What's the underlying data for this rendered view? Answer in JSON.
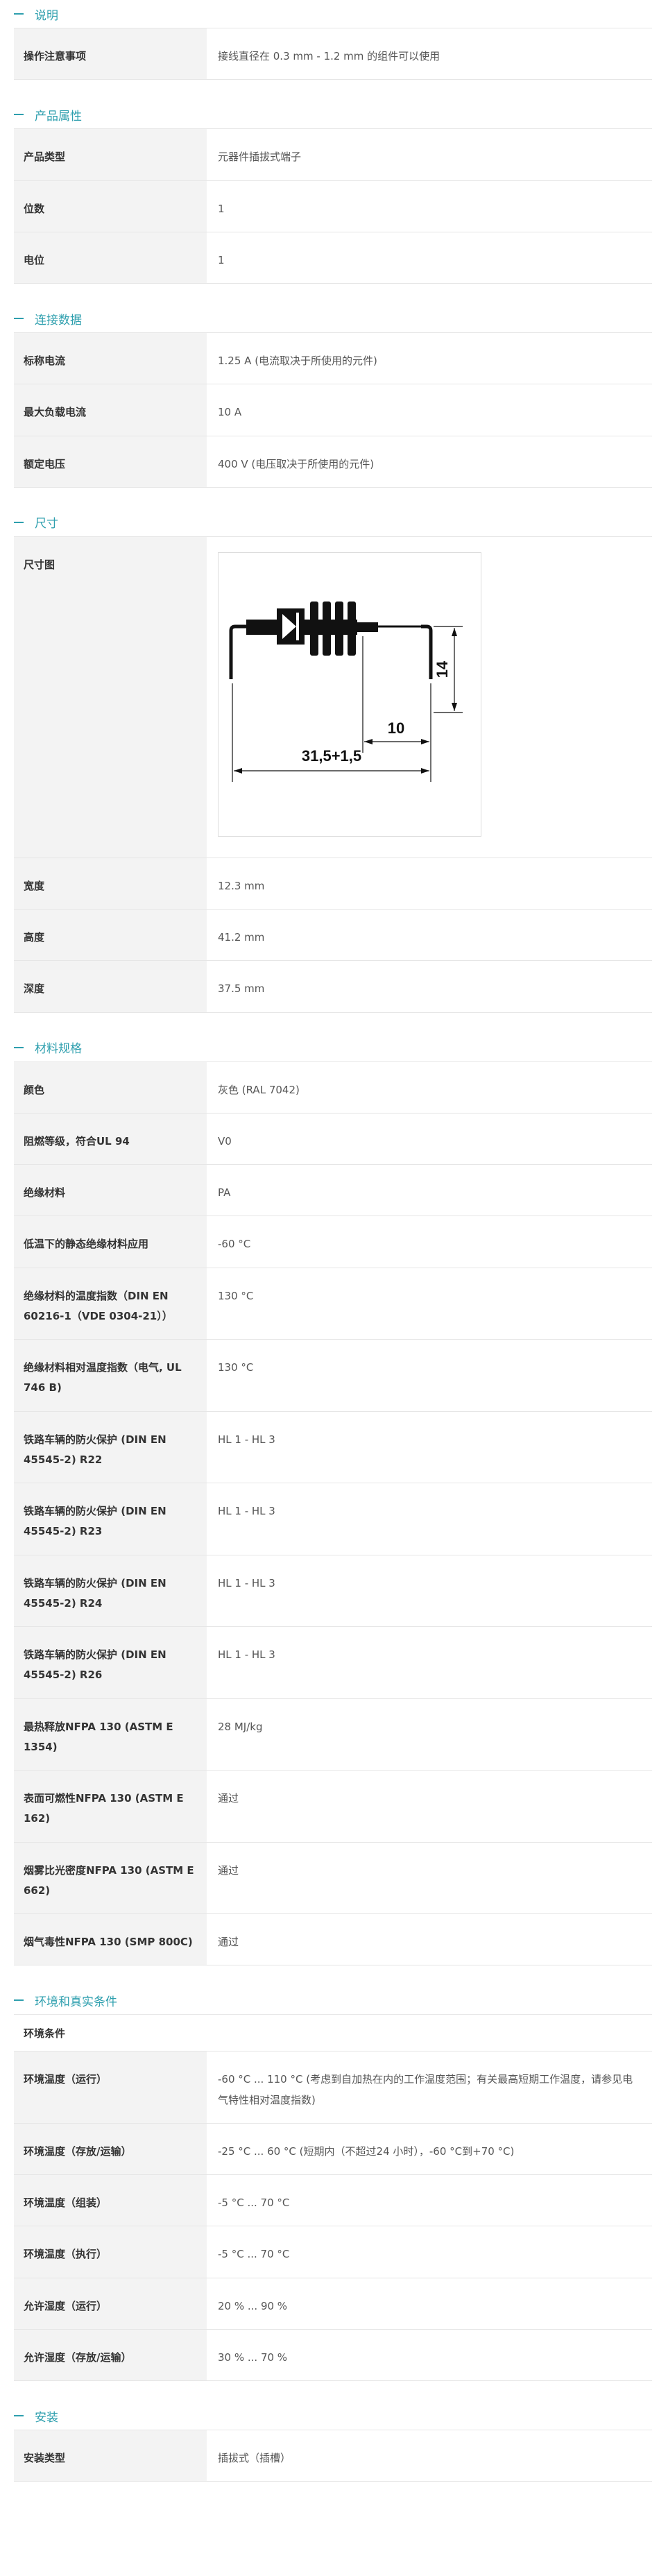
{
  "sections": {
    "description": {
      "title": "说明",
      "rows": [
        {
          "label": "操作注意事项",
          "value": "接线直径在 0.3 mm - 1.2 mm 的组件可以使用"
        }
      ]
    },
    "product": {
      "title": "产品属性",
      "rows": [
        {
          "label": "产品类型",
          "value": "元器件插拔式端子"
        },
        {
          "label": "位数",
          "value": "1"
        },
        {
          "label": "电位",
          "value": "1"
        }
      ]
    },
    "connection": {
      "title": "连接数据",
      "rows": [
        {
          "label": "标称电流",
          "value": "1.25 A (电流取决于所使用的元件)"
        },
        {
          "label": "最大负载电流",
          "value": "10 A"
        },
        {
          "label": "额定电压",
          "value": "400 V (电压取决于所使用的元件)"
        }
      ]
    },
    "dimensions": {
      "title": "尺寸",
      "drawing_label": "尺寸图",
      "drawing": {
        "dim_width": "31,5+1,5",
        "dim_gap": "10",
        "dim_height": "14"
      },
      "rows": [
        {
          "label": "宽度",
          "value": "12.3 mm"
        },
        {
          "label": "高度",
          "value": "41.2 mm"
        },
        {
          "label": "深度",
          "value": "37.5 mm"
        }
      ]
    },
    "material": {
      "title": "材料规格",
      "rows": [
        {
          "label": "颜色",
          "value": "灰色 (RAL 7042)"
        },
        {
          "label": "阻燃等级，符合UL 94",
          "value": "V0"
        },
        {
          "label": "绝缘材料",
          "value": "PA"
        },
        {
          "label": "低温下的静态绝缘材料应用",
          "value": "-60 °C"
        },
        {
          "label": "绝缘材料的温度指数（DIN EN 60216-1（VDE 0304-21））",
          "value": "130 °C"
        },
        {
          "label": "绝缘材料相对温度指数（电气, UL 746 B)",
          "value": "130 °C"
        },
        {
          "label": "铁路车辆的防火保护 (DIN EN 45545-2) R22",
          "value": "HL 1 - HL 3"
        },
        {
          "label": "铁路车辆的防火保护 (DIN EN 45545-2) R23",
          "value": "HL 1 - HL 3"
        },
        {
          "label": "铁路车辆的防火保护 (DIN EN 45545-2) R24",
          "value": "HL 1 - HL 3"
        },
        {
          "label": "铁路车辆的防火保护 (DIN EN 45545-2) R26",
          "value": "HL 1 - HL 3"
        },
        {
          "label": "最热释放NFPA 130 (ASTM E 1354)",
          "value": "28 MJ/kg"
        },
        {
          "label": "表面可燃性NFPA 130 (ASTM E 162)",
          "value": "通过"
        },
        {
          "label": "烟雾比光密度NFPA 130 (ASTM E 662)",
          "value": "通过"
        },
        {
          "label": "烟气毒性NFPA 130 (SMP 800C)",
          "value": "通过"
        }
      ]
    },
    "environment": {
      "title": "环境和真实条件",
      "subheading": "环境条件",
      "rows": [
        {
          "label": "环境温度（运行）",
          "value": "-60 °C ... 110 °C (考虑到自加热在内的工作温度范围；有关最高短期工作温度，请参见电气特性相对温度指数)"
        },
        {
          "label": "环境温度（存放/运输）",
          "value": "-25 °C ... 60 °C (短期内（不超过24 小时），-60 °C到+70 °C)"
        },
        {
          "label": "环境温度（组装）",
          "value": "-5 °C ... 70 °C"
        },
        {
          "label": "环境温度（执行）",
          "value": "-5 °C ... 70 °C"
        },
        {
          "label": "允许湿度（运行）",
          "value": "20 % ... 90 %"
        },
        {
          "label": "允许湿度（存放/运输）",
          "value": "30 % ... 70 %"
        }
      ]
    },
    "installation": {
      "title": "安装",
      "rows": [
        {
          "label": "安装类型",
          "value": "插拔式（插槽）"
        }
      ]
    }
  },
  "colors": {
    "accent": "#2e9fae",
    "label_bg": "#f3f3f3",
    "border": "#e6e6e6"
  }
}
